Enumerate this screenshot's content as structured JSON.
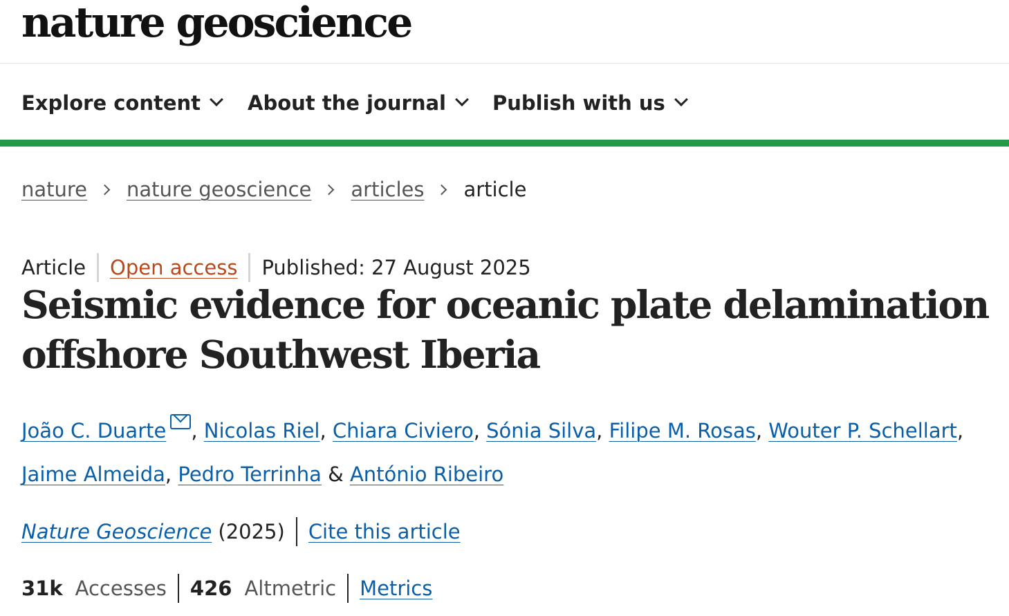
{
  "header": {
    "logo_text": "nature geoscience"
  },
  "nav": {
    "items": [
      {
        "label": "Explore content"
      },
      {
        "label": "About the journal"
      },
      {
        "label": "Publish with us"
      }
    ],
    "accent_color": "#239b47"
  },
  "breadcrumb": {
    "items": [
      {
        "label": "nature"
      },
      {
        "label": "nature geoscience"
      },
      {
        "label": "articles"
      }
    ],
    "current": "article"
  },
  "article": {
    "type": "Article",
    "access": "Open access",
    "published": "Published: 27 August 2025",
    "title": "Seismic evidence for oceanic plate delamination offshore Southwest Iberia",
    "authors": [
      {
        "name": "João C. Duarte",
        "separator": ", "
      },
      {
        "name": "Nicolas Riel",
        "separator": ", "
      },
      {
        "name": "Chiara Civiero",
        "separator": ", "
      },
      {
        "name": "Sónia Silva",
        "separator": ", "
      },
      {
        "name": "Filipe M. Rosas",
        "separator": ", "
      },
      {
        "name": "Wouter P. Schellart",
        "separator": ", "
      },
      {
        "name": "Jaime Almeida",
        "separator": ", "
      },
      {
        "name": "Pedro Terrinha",
        "separator": " & "
      },
      {
        "name": "António Ribeiro",
        "separator": ""
      }
    ],
    "journal": "Nature Geoscience",
    "year": "(2025)",
    "cite_label": "Cite this article",
    "metrics": {
      "accesses_value": "31k",
      "accesses_label": "Accesses",
      "altmetric_value": "426",
      "altmetric_label": "Altmetric",
      "metrics_link": "Metrics"
    }
  },
  "colors": {
    "link": "#0b5ea8",
    "open_access": "#b9491c",
    "text": "#222222"
  },
  "icons": {
    "corresponding_author": "mail-icon",
    "nav_dropdown": "chevron-down-icon",
    "breadcrumb_separator": "chevron-right-icon"
  }
}
